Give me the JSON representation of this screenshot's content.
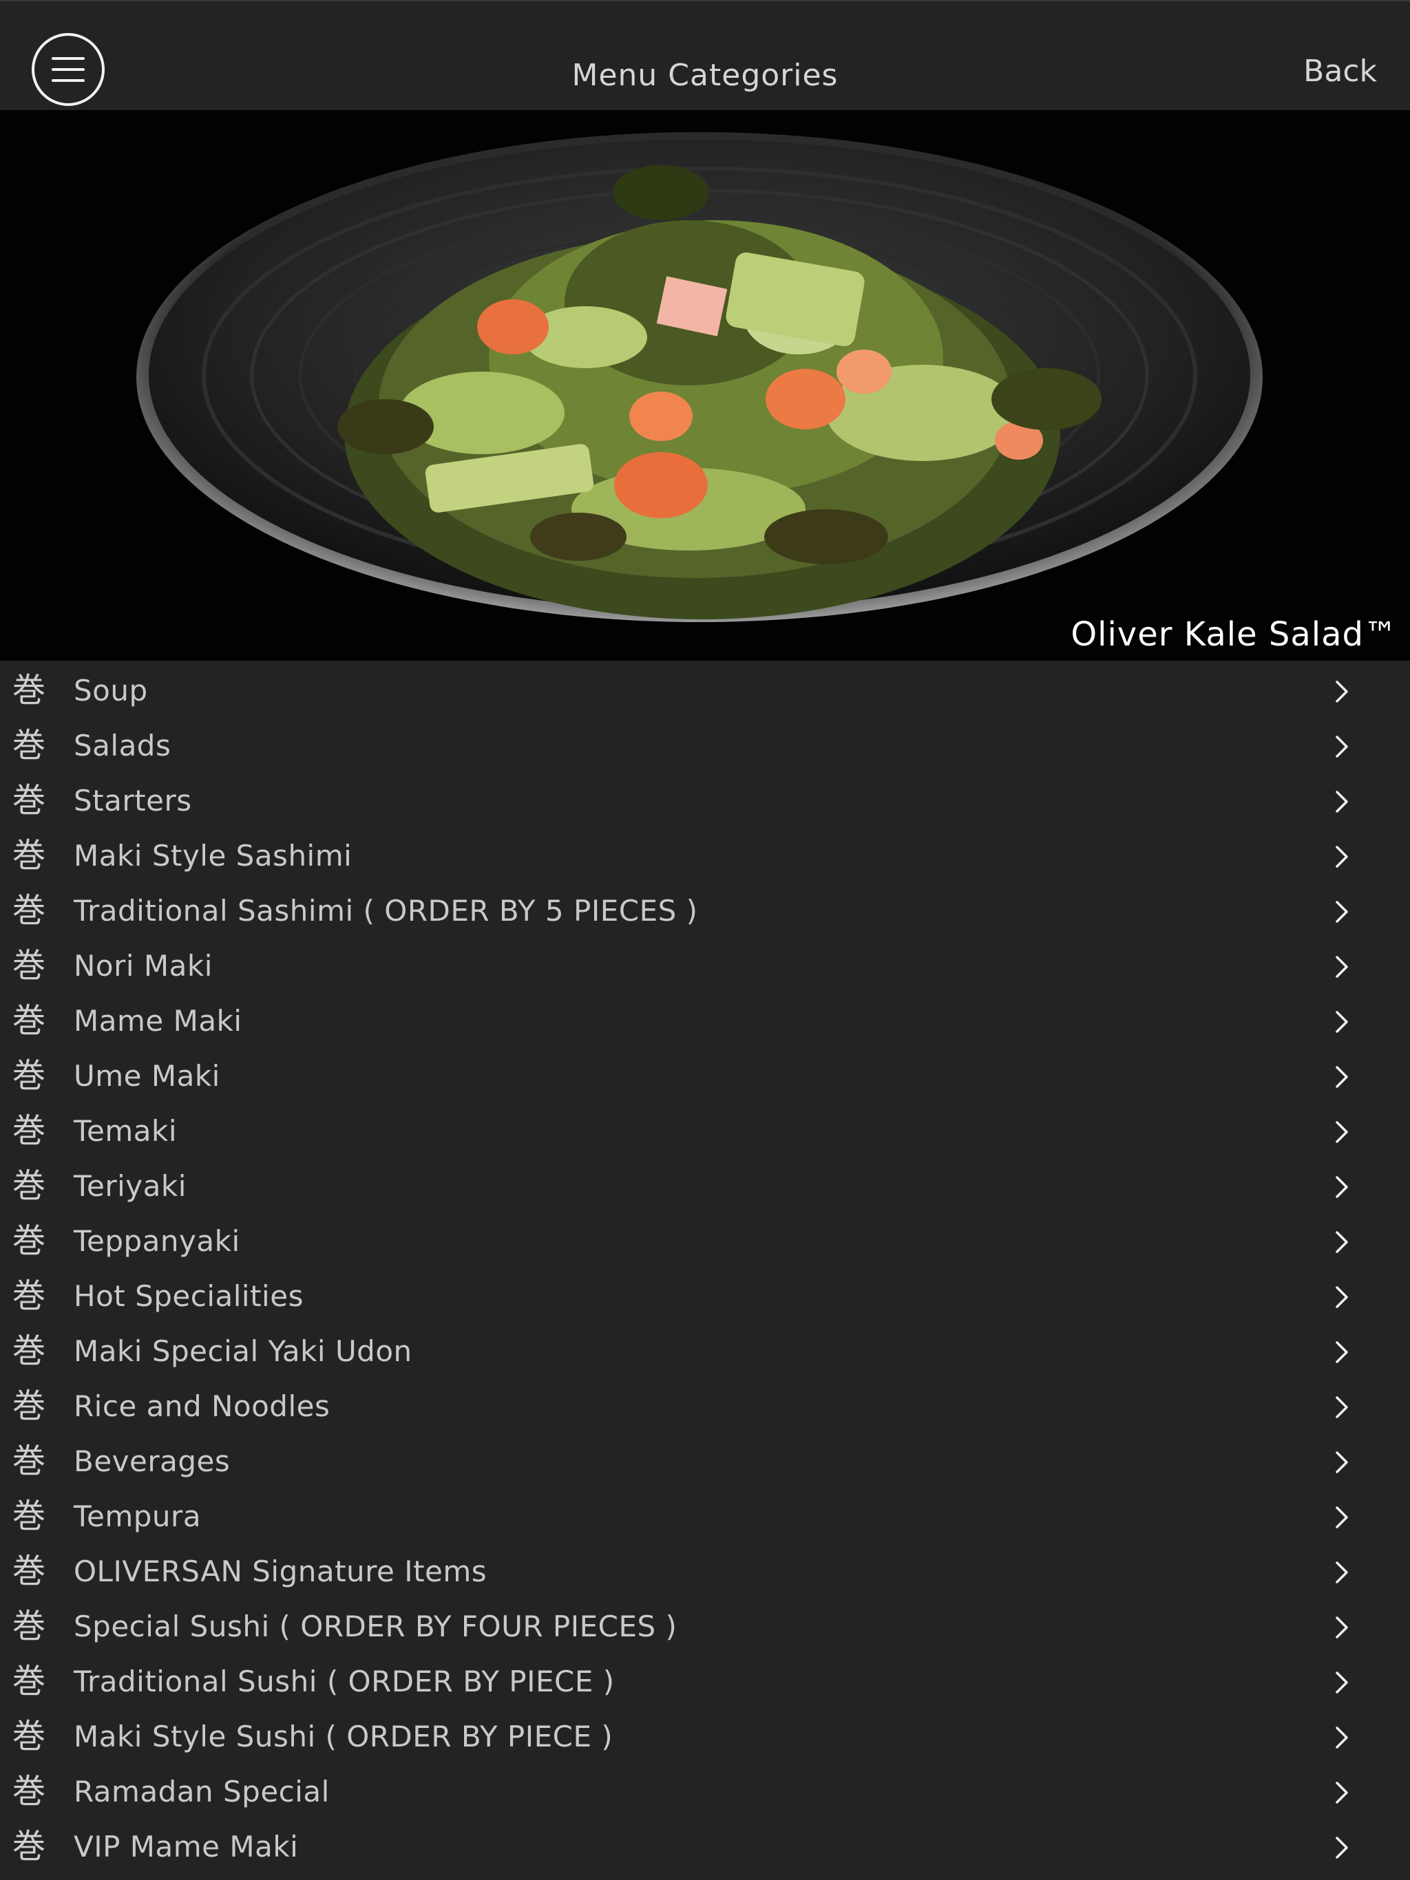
{
  "header": {
    "title": "Menu Categories",
    "back_label": "Back",
    "menu_icon": "hamburger-menu-icon"
  },
  "hero": {
    "caption": "Oliver Kale Salad™",
    "image_description_icon": "salad-dish-image"
  },
  "categories": {
    "glyph": "巻",
    "chevron_icon": "chevron-right-icon",
    "items": [
      {
        "label": "Soup"
      },
      {
        "label": "Salads"
      },
      {
        "label": "Starters"
      },
      {
        "label": "Maki Style Sashimi"
      },
      {
        "label": "Traditional Sashimi ( ORDER BY 5 PIECES )"
      },
      {
        "label": "Nori Maki"
      },
      {
        "label": "Mame Maki"
      },
      {
        "label": "Ume Maki"
      },
      {
        "label": "Temaki"
      },
      {
        "label": "Teriyaki"
      },
      {
        "label": "Teppanyaki"
      },
      {
        "label": "Hot Specialities"
      },
      {
        "label": "Maki Special Yaki Udon"
      },
      {
        "label": "Rice and Noodles"
      },
      {
        "label": "Beverages"
      },
      {
        "label": "Tempura"
      },
      {
        "label": "OLIVERSAN Signature Items"
      },
      {
        "label": "Special Sushi ( ORDER BY FOUR PIECES )"
      },
      {
        "label": "Traditional Sushi ( ORDER BY PIECE )"
      },
      {
        "label": "Maki Style Sushi ( ORDER BY PIECE )"
      },
      {
        "label": "Ramadan Special"
      },
      {
        "label": "VIP Mame Maki"
      }
    ]
  },
  "colors": {
    "background": "#232323",
    "text": "#c9c9c9",
    "hero_background": "#020202"
  }
}
